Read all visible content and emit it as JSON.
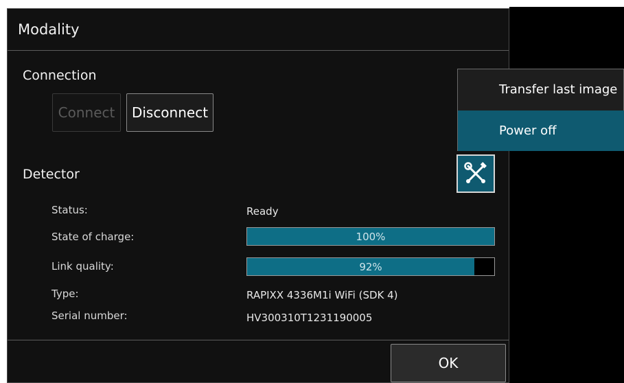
{
  "dialog": {
    "title": "Modality",
    "connection": {
      "heading": "Connection",
      "connect_label": "Connect",
      "disconnect_label": "Disconnect"
    },
    "detector": {
      "heading": "Detector",
      "fields": {
        "status": {
          "label": "Status:",
          "value": "Ready"
        },
        "state_of_charge": {
          "label": "State of charge:",
          "percent": 100,
          "text": "100%"
        },
        "link_quality": {
          "label": "Link quality:",
          "percent": 92,
          "text": "92%"
        },
        "type": {
          "label": "Type:",
          "value": "RAPIXX 4336M1i WiFi (SDK 4)"
        },
        "serial": {
          "label": "Serial number:",
          "value": "HV300310T1231190005"
        }
      },
      "tools_icon": "tools-icon"
    },
    "ok_label": "OK"
  },
  "context_menu": {
    "items": [
      {
        "label": "Transfer last image",
        "active": false
      },
      {
        "label": "Power off",
        "active": true
      }
    ]
  },
  "colors": {
    "accent": "#0f5a70",
    "progress": "#0e6e86",
    "background": "#111111"
  }
}
